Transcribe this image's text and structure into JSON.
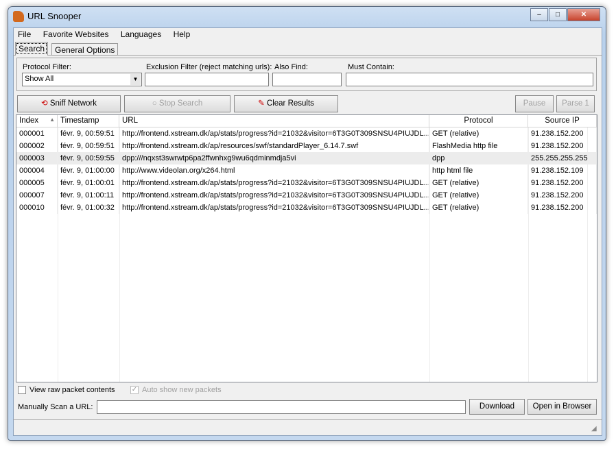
{
  "window": {
    "title": "URL Snooper",
    "min": "–",
    "max": "□",
    "close": "✕"
  },
  "menu": [
    "File",
    "Favorite Websites",
    "Languages",
    "Help"
  ],
  "tabs": [
    "Search",
    "General Options"
  ],
  "filters": {
    "protocol_label": "Protocol Filter:",
    "protocol_value": "Show All",
    "exclusion_label": "Exclusion Filter (reject matching urls):",
    "exclusion_value": "",
    "also_find_label": "Also Find:",
    "also_find_value": "",
    "must_contain_label": "Must Contain:",
    "must_contain_value": ""
  },
  "buttons": {
    "sniff": "Sniff Network",
    "stop": "Stop Search",
    "clear": "Clear Results",
    "pause": "Pause",
    "parse": "Parse 1",
    "download": "Download",
    "open": "Open in Browser"
  },
  "table": {
    "columns": [
      "Index",
      "Timestamp",
      "URL",
      "Protocol",
      "Source IP"
    ],
    "rows": [
      [
        "000001",
        "févr. 9, 00:59:51",
        "http://frontend.xstream.dk/ap/stats/progress?id=21032&visitor=6T3G0T309SNSU4PIUJDL...",
        "GET (relative)",
        "91.238.152.200"
      ],
      [
        "000002",
        "févr. 9, 00:59:51",
        "http://frontend.xstream.dk/ap/resources/swf/standardPlayer_6.14.7.swf",
        "FlashMedia http file",
        "91.238.152.200"
      ],
      [
        "000003",
        "févr. 9, 00:59:55",
        "dpp:///nqxst3swrwtp6pa2ffwnhxg9wu6qdminmdja5vi",
        "dpp",
        "255.255.255.255"
      ],
      [
        "000004",
        "févr. 9, 01:00:00",
        "http://www.videolan.org/x264.html",
        "http html file",
        "91.238.152.109"
      ],
      [
        "000005",
        "févr. 9, 01:00:01",
        "http://frontend.xstream.dk/ap/stats/progress?id=21032&visitor=6T3G0T309SNSU4PIUJDL...",
        "GET (relative)",
        "91.238.152.200"
      ],
      [
        "000007",
        "févr. 9, 01:00:11",
        "http://frontend.xstream.dk/ap/stats/progress?id=21032&visitor=6T3G0T309SNSU4PIUJDL...",
        "GET (relative)",
        "91.238.152.200"
      ],
      [
        "000010",
        "févr. 9, 01:00:32",
        "http://frontend.xstream.dk/ap/stats/progress?id=21032&visitor=6T3G0T309SNSU4PIUJDL...",
        "GET (relative)",
        "91.238.152.200"
      ]
    ]
  },
  "options": {
    "raw": "View raw packet contents",
    "auto": "Auto show new packets",
    "manual_label": "Manually Scan a URL:",
    "manual_value": ""
  }
}
